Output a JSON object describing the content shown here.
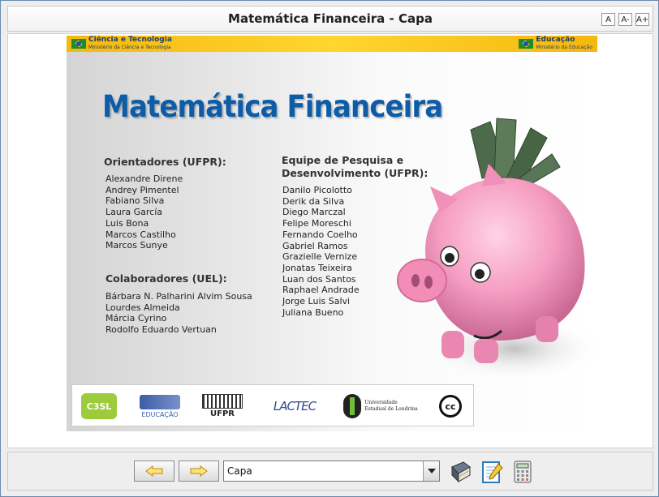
{
  "window": {
    "title": "Matemática Financeira - Capa"
  },
  "font_controls": [
    "A",
    "A-",
    "A+"
  ],
  "gov": {
    "left_title": "Ciência e Tecnologia",
    "left_sub": "Ministério da Ciência e Tecnologia",
    "right_title": "Educação",
    "right_sub": "Ministério da Educação"
  },
  "slide": {
    "title": "Matemática Financeira",
    "orientadores_heading": "Orientadores (UFPR):",
    "orientadores": [
      "Alexandre Direne",
      "Andrey Pimentel",
      "Fabiano Silva",
      "Laura García",
      "Luis Bona",
      "Marcos Castilho",
      "Marcos Sunye"
    ],
    "colaboradores_heading": "Colaboradores (UEL):",
    "colaboradores": [
      "Bárbara N. Palharini Alvim Sousa",
      "Lourdes Almeida",
      "Márcia Cyrino",
      "Rodolfo Eduardo Vertuan"
    ],
    "equipe_heading_1": "Equipe de Pesquisa e",
    "equipe_heading_2": "Desenvolvimento (UFPR):",
    "equipe": [
      "Danilo Picolotto",
      "Derik da Silva",
      "Diego Marczal",
      "Felipe Moreschi",
      "Fernando Coelho",
      "Gabriel Ramos",
      "Grazielle Vernize",
      "Jonatas Teixeira",
      "Luan dos Santos",
      "Raphael Andrade",
      "Jorge Luis Salvi",
      "Juliana Bueno"
    ]
  },
  "logos": {
    "c3sl": "C3SL",
    "educacao": "EDUCAÇÃO",
    "ufpr": "UFPR",
    "lactec": "LACTEC",
    "uel_1": "Universidade",
    "uel_2": "Estadual de Londrina",
    "cc": "cc"
  },
  "nav": {
    "selected_page": "Capa"
  },
  "colors": {
    "title_blue": "#0d5ca8",
    "gov_yellow": "#ffd530",
    "pig_pink": "#f59dc2"
  },
  "icons": [
    "arrow-left-icon",
    "arrow-right-icon",
    "chevron-down-icon",
    "book-icon",
    "notepad-icon",
    "calculator-icon"
  ]
}
